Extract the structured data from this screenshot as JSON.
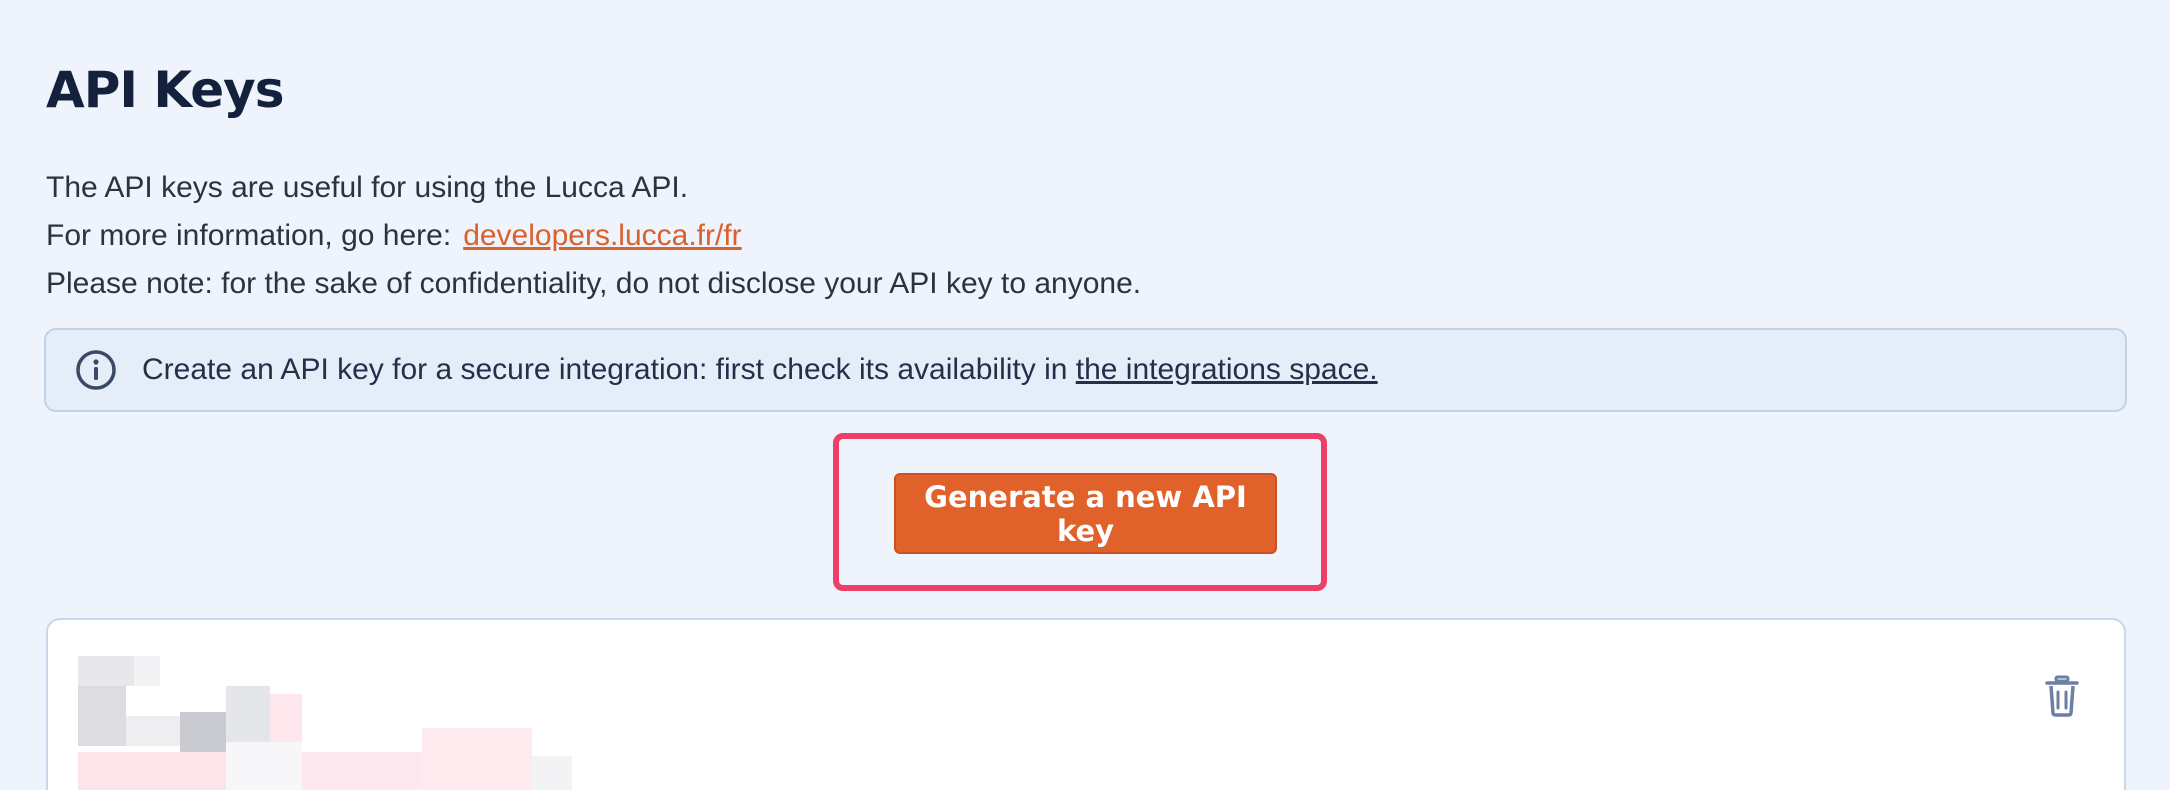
{
  "header": {
    "title": "API Keys"
  },
  "intro": {
    "line1": "The API keys are useful for using the Lucca API.",
    "line2_prefix": "For more information, go here:",
    "line2_link": "developers.lucca.fr/fr",
    "line3": "Please note: for the sake of confidentiality, do not disclose your API key to anyone."
  },
  "info_banner": {
    "icon": "info-circle-icon",
    "text": "Create an API key for a secure integration: first check its availability in ",
    "link": "the integrations space."
  },
  "actions": {
    "generate_label": "Generate a new API key"
  },
  "key_card": {
    "delete_icon": "trash-icon"
  },
  "colors": {
    "background": "#eff3fb",
    "accent": "#e0612a",
    "link": "#d9612b",
    "highlight": "#ef3e6a",
    "title": "#14213d"
  }
}
